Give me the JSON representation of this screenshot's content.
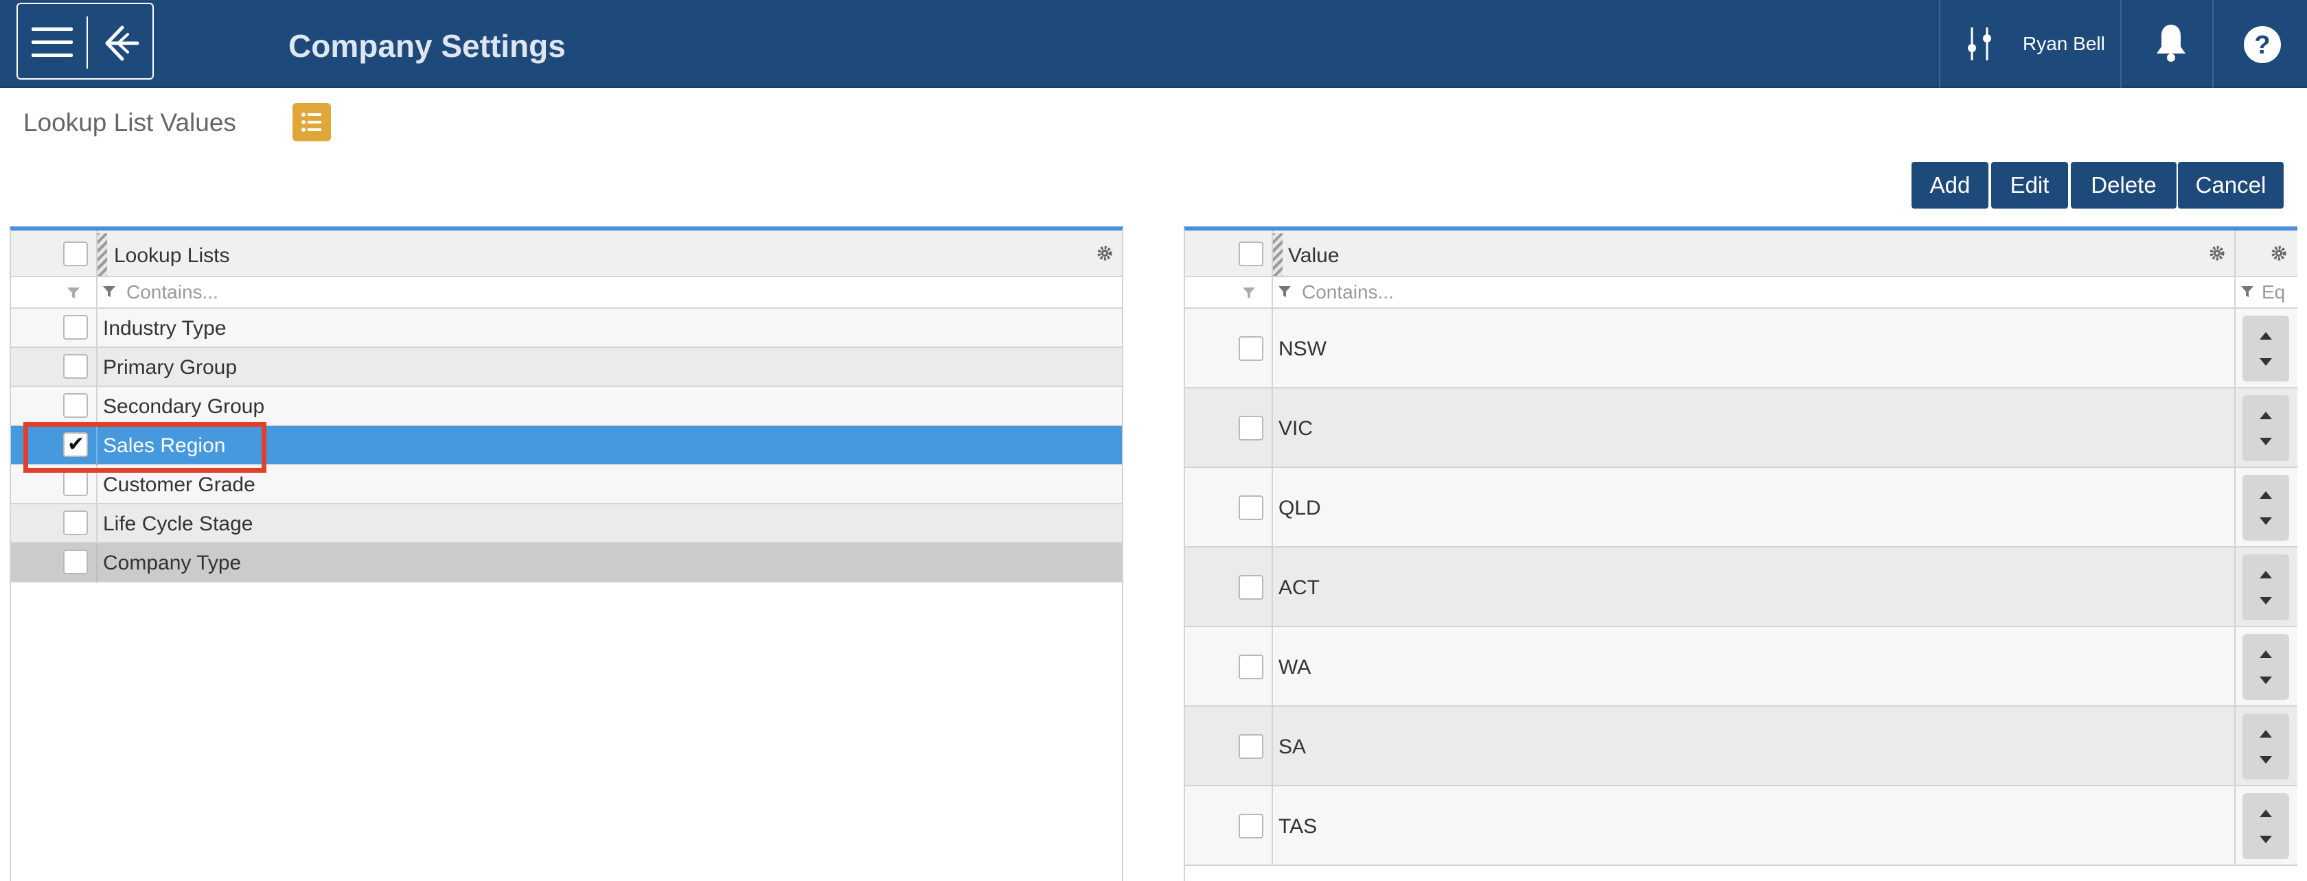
{
  "header": {
    "title": "Company Settings",
    "user_name": "Ryan Bell",
    "brand_color": "#1e4a7b"
  },
  "subheader": {
    "title": "Lookup List Values"
  },
  "actions": {
    "add": "Add",
    "edit": "Edit",
    "delete": "Delete",
    "cancel": "Cancel"
  },
  "lookup_grid": {
    "column_title": "Lookup Lists",
    "filter_placeholder": "Contains...",
    "rows": [
      {
        "label": "Industry Type",
        "checked": false
      },
      {
        "label": "Primary Group",
        "checked": false
      },
      {
        "label": "Secondary Group",
        "checked": false
      },
      {
        "label": "Sales Region",
        "checked": true
      },
      {
        "label": "Customer Grade",
        "checked": false
      },
      {
        "label": "Life Cycle Stage",
        "checked": false
      },
      {
        "label": "Company Type",
        "checked": false
      }
    ]
  },
  "values_grid": {
    "column_title": "Value",
    "filter_placeholder": "Contains...",
    "sort_filter_placeholder": "Eq",
    "rows": [
      {
        "label": "NSW"
      },
      {
        "label": "VIC"
      },
      {
        "label": "QLD"
      },
      {
        "label": "ACT"
      },
      {
        "label": "WA"
      },
      {
        "label": "SA"
      },
      {
        "label": "TAS"
      }
    ]
  },
  "icons": {
    "menu": "hamburger-icon",
    "logo": "logo-icon",
    "filters": "sliders-icon",
    "notifications": "bell-icon",
    "help": "help-icon",
    "list": "list-icon",
    "settings": "gear-icon",
    "filter": "funnel-icon",
    "sort": "sort-arrows-icon"
  }
}
